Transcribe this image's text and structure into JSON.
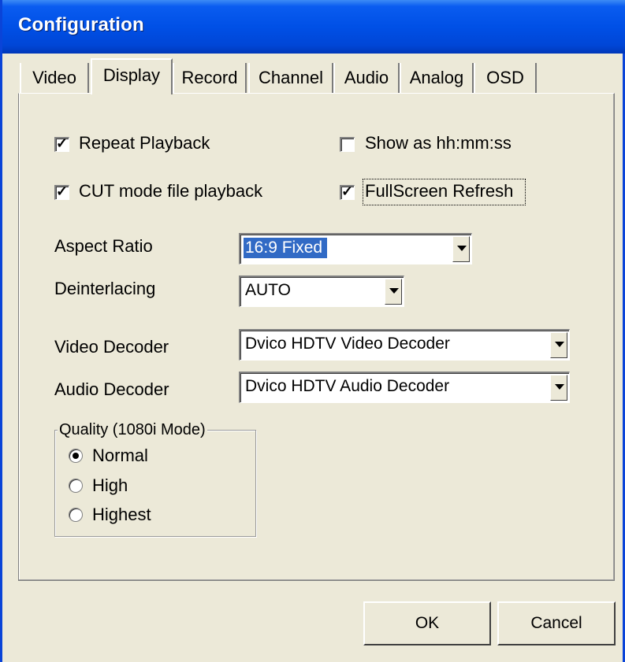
{
  "window": {
    "title": "Configuration"
  },
  "tabs": [
    {
      "label": "Video"
    },
    {
      "label": "Display"
    },
    {
      "label": "Record"
    },
    {
      "label": "Channel"
    },
    {
      "label": "Audio"
    },
    {
      "label": "Analog"
    },
    {
      "label": "OSD"
    }
  ],
  "active_tab": "Display",
  "options": {
    "repeat_playback": {
      "label": "Repeat Playback",
      "checked": true
    },
    "show_hhmmss": {
      "label": "Show as hh:mm:ss",
      "checked": false
    },
    "cut_mode": {
      "label": "CUT mode file playback",
      "checked": true
    },
    "fullscreen_refresh": {
      "label": "FullScreen Refresh",
      "checked": true
    }
  },
  "fields": {
    "aspect_ratio": {
      "label": "Aspect Ratio",
      "value": "16:9 Fixed"
    },
    "deinterlacing": {
      "label": "Deinterlacing",
      "value": "AUTO"
    },
    "video_decoder": {
      "label": "Video Decoder",
      "value": "Dvico HDTV Video Decoder"
    },
    "audio_decoder": {
      "label": "Audio Decoder",
      "value": "Dvico HDTV Audio Decoder"
    }
  },
  "quality": {
    "legend": "Quality (1080i Mode)",
    "options": [
      "Normal",
      "High",
      "Highest"
    ],
    "selected": "Normal"
  },
  "buttons": {
    "ok": "OK",
    "cancel": "Cancel"
  },
  "colors": {
    "titlebar": "#0050e6",
    "selection": "#316ac5",
    "dialog_bg": "#ece9d8"
  }
}
